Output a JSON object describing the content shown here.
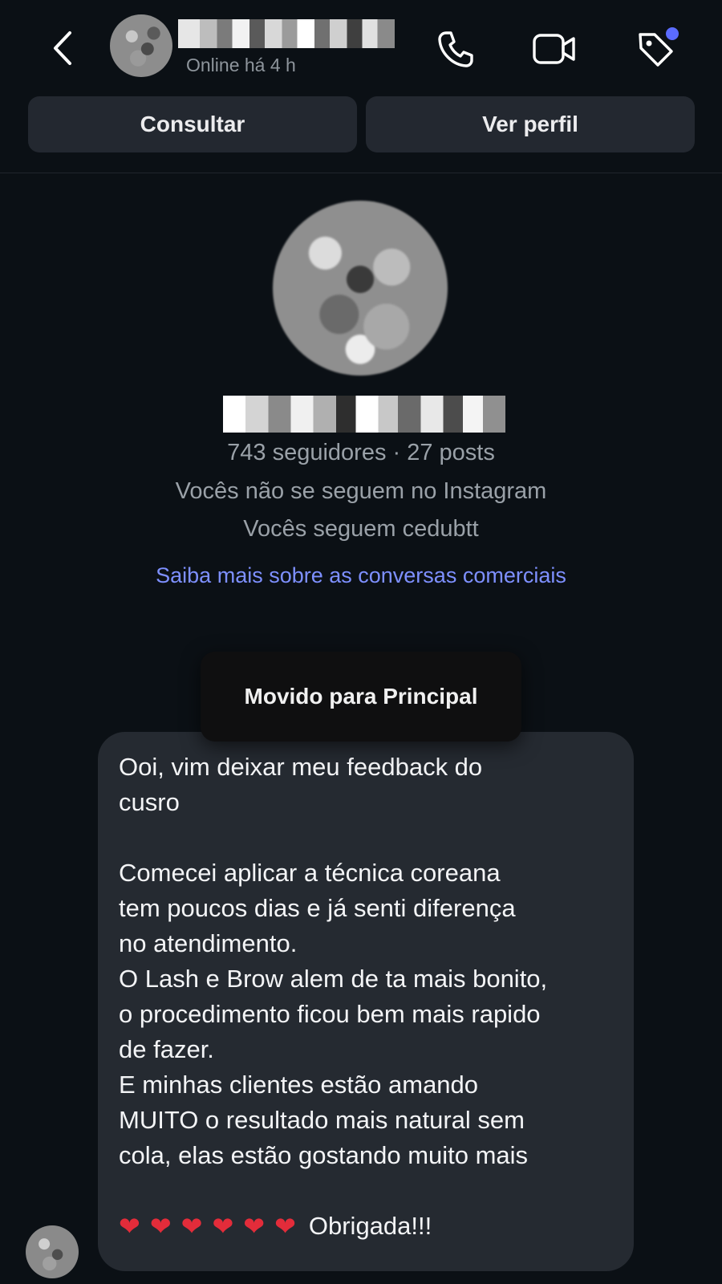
{
  "header": {
    "status": "Online há 4 h",
    "consult_label": "Consultar",
    "profile_label": "Ver perfil",
    "icons": [
      "back-arrow-icon",
      "phone-icon",
      "video-camera-icon",
      "tag-icon"
    ],
    "accent": "#5b6cff"
  },
  "profile": {
    "stats": "743 seguidores · 27 posts",
    "follow_line_1": "Vocês não se seguem no Instagram",
    "follow_line_2": "Vocês seguem cedubtt",
    "learn_more": "Saiba mais sobre as conversas comerciais"
  },
  "toast": {
    "text": "Movido para Principal"
  },
  "message": {
    "para1": "Ooi, vim deixar meu feedback do\ncusro",
    "para2": "Comecei aplicar a técnica coreana\ntem poucos dias e já senti diferença\nno atendimento.\nO Lash e Brow alem de ta mais bonito,\no procedimento ficou bem mais rapido\nde fazer.\nE minhas clientes estão amando\nMUITO o resultado mais natural sem\ncola, elas estão gostando muito mais",
    "hearts": [
      "❤",
      "❤",
      "❤",
      "❤",
      "❤",
      "❤"
    ],
    "closing": "Obrigada!!!"
  }
}
